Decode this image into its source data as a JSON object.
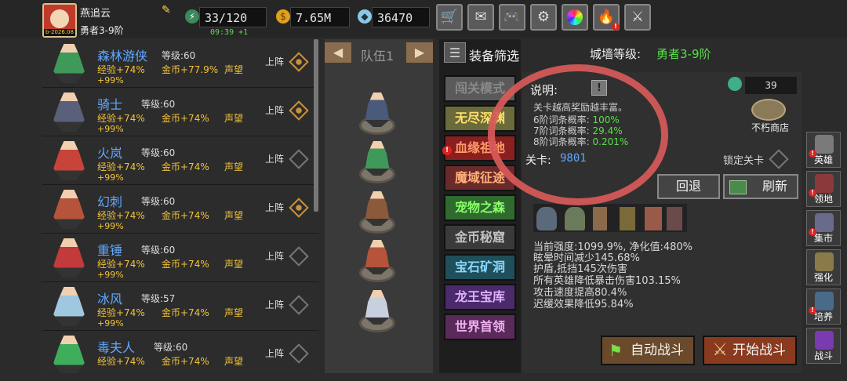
{
  "player": {
    "name": "燕追云",
    "rank": "勇者3-9阶",
    "avatar_tag": "b-2026.08",
    "energy": "33/120",
    "energy_timer": "09:39 +1",
    "gold": "7.65M",
    "gems": "36470"
  },
  "topbar_icons": [
    "shop-cart-icon",
    "mail-icon",
    "gamepad-icon",
    "settings-gear-icon",
    "color-wheel-icon",
    "bonfire-icon",
    "crossed-swords-icon"
  ],
  "heroes": [
    {
      "name": "森林游侠",
      "level": "等级:60",
      "exp": "经验+74%",
      "gold": "金币+77.9%",
      "fame": "声望",
      "pct": "+99%",
      "action": "上阵",
      "selected": true,
      "color": "#3f9a5a"
    },
    {
      "name": "骑士",
      "level": "等级:60",
      "exp": "经验+74%",
      "gold": "金币+74%",
      "fame": "声望",
      "pct": "+99%",
      "action": "上阵",
      "selected": true,
      "color": "#5a5f7a"
    },
    {
      "name": "火岚",
      "level": "等级:60",
      "exp": "经验+74%",
      "gold": "金币+74%",
      "fame": "声望",
      "pct": "+99%",
      "action": "上阵",
      "selected": false,
      "color": "#c8443a"
    },
    {
      "name": "幻刺",
      "level": "等级:60",
      "exp": "经验+74%",
      "gold": "金币+74%",
      "fame": "声望",
      "pct": "+99%",
      "action": "上阵",
      "selected": true,
      "color": "#b5543a"
    },
    {
      "name": "重锤",
      "level": "等级:60",
      "exp": "经验+74%",
      "gold": "金币+74%",
      "fame": "声望",
      "pct": "+99%",
      "action": "上阵",
      "selected": false,
      "color": "#c23a3a"
    },
    {
      "name": "冰风",
      "level": "等级:57",
      "exp": "经验+74%",
      "gold": "金币+74%",
      "fame": "声望",
      "pct": "+99%",
      "action": "上阵",
      "selected": false,
      "color": "#9fc8e0"
    },
    {
      "name": "毒夫人",
      "level": "等级:60",
      "exp": "经验+74%",
      "gold": "金币+74%",
      "fame": "声望",
      "pct": "",
      "action": "上阵",
      "selected": false,
      "color": "#3fae5a"
    }
  ],
  "team": {
    "label": "队伍1",
    "left_arrow": "◀",
    "right_arrow": "▶"
  },
  "filter": {
    "icon": "☰",
    "label": "装备筛选"
  },
  "modes": [
    {
      "label": "闯关模式",
      "color": "#5a5a5a",
      "text": "#8a8a8a"
    },
    {
      "label": "无尽深渊",
      "color": "#6a6a3a",
      "text": "#ffe06a"
    },
    {
      "label": "血缘祖地",
      "color": "#8a1f1f",
      "text": "#ff9a6a"
    },
    {
      "label": "魔域征途",
      "color": "#6a2a2a",
      "text": "#ffb07a"
    },
    {
      "label": "宠物之森",
      "color": "#2f6a2f",
      "text": "#8aff6a"
    },
    {
      "label": "金币秘窟",
      "color": "#3a3a3a",
      "text": "#c0c0c0"
    },
    {
      "label": "宝石矿洞",
      "color": "#1f4f5a",
      "text": "#8ad8ff"
    },
    {
      "label": "龙王宝库",
      "color": "#4a2a6a",
      "text": "#e0b0ff"
    },
    {
      "label": "世界首领",
      "color": "#5a2a5a",
      "text": "#f0b0f0"
    }
  ],
  "wall": {
    "label": "城墙等级:",
    "value": "勇者3-9阶"
  },
  "stage_info": {
    "desc_label": "说明:",
    "info_icon": "!",
    "lines": [
      {
        "text": "关卡越高奖励越丰富。",
        "value": ""
      },
      {
        "text": "6阶词条概率:",
        "value": "100%"
      },
      {
        "text": "7阶词条概率:",
        "value": "29.4%"
      },
      {
        "text": "8阶词条概率:",
        "value": "0.201%"
      }
    ],
    "stage_label": "关卡:",
    "stage_number": "9801",
    "lock_label": "锁定关卡",
    "token_count": "39",
    "shop_label": "不朽商店",
    "back_button": "回退",
    "refresh_button": "刷新",
    "stats": [
      "当前强度:1099.9%, 净化值:480%",
      "眩晕时间减少145.68%",
      "护盾,抵挡145次伤害",
      "所有英雄降低暴击伤害103.15%",
      "攻击速度提高80.4%",
      "迟缓效果降低95.84%"
    ],
    "auto_battle": "自动战斗",
    "start_battle": "开始战斗"
  },
  "side_menu": [
    {
      "label": "英雄",
      "color": "#7a7a7a",
      "alert": true
    },
    {
      "label": "领地",
      "color": "#8a3a3a",
      "alert": true
    },
    {
      "label": "集市",
      "color": "#6a6a8a",
      "alert": true
    },
    {
      "label": "强化",
      "color": "#8a7a4a",
      "alert": false
    },
    {
      "label": "培养",
      "color": "#4a6a8a",
      "alert": true
    },
    {
      "label": "战斗",
      "color": "#7a3ab0",
      "alert": false
    }
  ]
}
